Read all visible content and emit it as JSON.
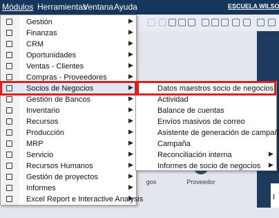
{
  "menubar": {
    "items": [
      "Módulos",
      "Herramientas",
      "Ventana",
      "Ayuda"
    ],
    "company": "ESCUELA WILSON E"
  },
  "background": {
    "tile_letter": "I",
    "item_left": "gos",
    "item_right": "Proveedor",
    "dollar": "$"
  },
  "main_menu": {
    "items": [
      {
        "label": "Gestión",
        "icon": "gestion-icon",
        "submenu": true
      },
      {
        "label": "Finanzas",
        "icon": "finanzas-icon",
        "submenu": true
      },
      {
        "label": "CRM",
        "icon": "crm-icon",
        "submenu": true
      },
      {
        "label": "Oportunidades",
        "icon": "oportunidades-icon",
        "submenu": true
      },
      {
        "label": "Ventas - Clientes",
        "icon": "ventas-icon",
        "submenu": true
      },
      {
        "label": "Compras - Proveedores",
        "icon": "compras-icon",
        "submenu": true
      },
      {
        "label": "Socios de Negocios",
        "icon": "socios-icon",
        "submenu": true
      },
      {
        "label": "Gestión de Bancos",
        "icon": "bancos-icon",
        "submenu": true
      },
      {
        "label": "Inventario",
        "icon": "inventario-icon",
        "submenu": true
      },
      {
        "label": "Recursos",
        "icon": "recursos-icon",
        "submenu": true
      },
      {
        "label": "Producción",
        "icon": "produccion-icon",
        "submenu": true
      },
      {
        "label": "MRP",
        "icon": "mrp-icon",
        "submenu": true
      },
      {
        "label": "Servicio",
        "icon": "servicio-icon",
        "submenu": true
      },
      {
        "label": "Recursos Humanos",
        "icon": "rrhh-icon",
        "submenu": true
      },
      {
        "label": "Gestión de proyectos",
        "icon": "proyectos-icon",
        "submenu": true
      },
      {
        "label": "Informes",
        "icon": "informes-icon",
        "submenu": true
      },
      {
        "label": "Excel Report e Interactive Analysis",
        "icon": "excel-icon",
        "submenu": true
      }
    ]
  },
  "sub_menu": {
    "items": [
      {
        "label": "Datos maestros socio de negocios",
        "submenu": false
      },
      {
        "label": "Actividad",
        "submenu": false
      },
      {
        "label": "Balance de cuentas",
        "submenu": false
      },
      {
        "label": "Envíos masivos de correo",
        "submenu": false
      },
      {
        "label": "Asistente de generación de campaña",
        "submenu": false
      },
      {
        "label": "Campaña",
        "submenu": false
      },
      {
        "label": "Reconciliación interna",
        "submenu": true
      },
      {
        "label": "Informes de socio de negocios",
        "submenu": true
      }
    ]
  },
  "colors": {
    "menubar": "#16365c",
    "highlight_border": "#e01e1e"
  }
}
